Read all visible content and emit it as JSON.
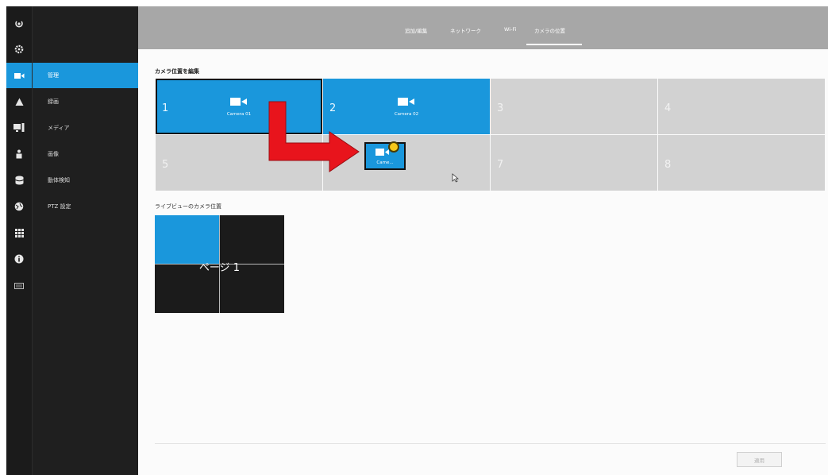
{
  "nav_menu": {
    "items": [
      {
        "label": "管理",
        "active": true
      },
      {
        "label": "録画",
        "active": false
      },
      {
        "label": "メディア",
        "active": false
      },
      {
        "label": "画像",
        "active": false
      },
      {
        "label": "動体検知",
        "active": false
      },
      {
        "label": "PTZ 設定",
        "active": false
      }
    ]
  },
  "icon_rail": {
    "icons": [
      "logout-icon",
      "gear-icon",
      "camera-icon",
      "alert-icon",
      "monitor-icon",
      "person-icon",
      "database-icon",
      "network-icon",
      "grid-icon",
      "info-icon",
      "keyboard-icon"
    ],
    "active": "camera-icon"
  },
  "tabs": [
    {
      "label": "追加/編集",
      "active": false
    },
    {
      "label": "ネットワーク",
      "active": false
    },
    {
      "label": "Wi-Fi",
      "active": false
    },
    {
      "label": "カメラの位置",
      "active": true
    }
  ],
  "edit_position": {
    "title": "カメラ位置を編集",
    "cells": [
      {
        "number": "1",
        "camera": "Camera 01",
        "selected": true
      },
      {
        "number": "2",
        "camera": "Camera 02",
        "selected": false
      },
      {
        "number": "3",
        "camera": "",
        "selected": false
      },
      {
        "number": "4",
        "camera": "",
        "selected": false
      },
      {
        "number": "5",
        "camera": "",
        "selected": false
      },
      {
        "number": "",
        "camera": "",
        "selected": false
      },
      {
        "number": "7",
        "camera": "",
        "selected": false
      },
      {
        "number": "8",
        "camera": "",
        "selected": false
      }
    ],
    "drag_ghost_label": "Came..."
  },
  "live_view": {
    "title": "ライブビューのカメラ位置",
    "page_label": "ページ 1"
  },
  "footer": {
    "apply_label": "適用"
  },
  "colors": {
    "accent": "#1a97dc",
    "arrow": "#e8141c",
    "topbar": "#a7a7a7",
    "sidebar": "#1f1f1f"
  }
}
